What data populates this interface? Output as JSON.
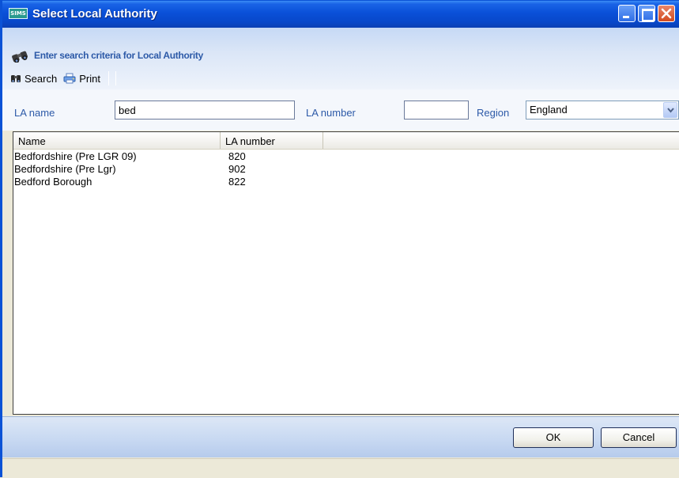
{
  "window": {
    "app_logo_text": "SIMS",
    "title": "Select Local Authority"
  },
  "header": {
    "heading": "Enter search criteria for Local Authority"
  },
  "toolbar": {
    "search_label": "Search",
    "print_label": "Print"
  },
  "criteria": {
    "la_name_label": "LA name",
    "la_name_value": "bed",
    "la_number_label": "LA number",
    "la_number_value": "",
    "region_label": "Region",
    "region_value": "England"
  },
  "results": {
    "columns": [
      "Name",
      "LA number"
    ],
    "rows": [
      {
        "name": "Bedfordshire (Pre LGR 09)",
        "la_number": "820"
      },
      {
        "name": "Bedfordshire (Pre Lgr)",
        "la_number": "902"
      },
      {
        "name": "Bedford Borough",
        "la_number": "822"
      }
    ]
  },
  "buttons": {
    "ok": "OK",
    "cancel": "Cancel"
  },
  "colors": {
    "titlebar": "#0a50d8",
    "label_blue": "#2d5aa8",
    "close_red": "#d34a1f"
  }
}
